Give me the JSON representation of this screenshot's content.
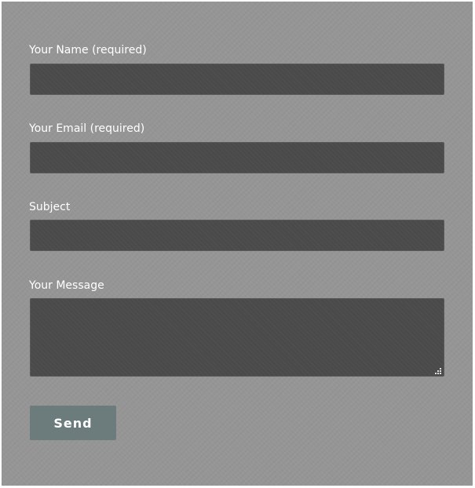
{
  "form": {
    "name_label": "Your Name (required)",
    "name_value": "",
    "email_label": "Your Email (required)",
    "email_value": "",
    "subject_label": "Subject",
    "subject_value": "",
    "message_label": "Your Message",
    "message_value": "",
    "send_label": "Send"
  },
  "colors": {
    "panel_bg": "#959595",
    "field_bg": "#4a4a4a",
    "button_bg": "#6c7b7c",
    "label_text": "#ffffff"
  },
  "icons": {
    "textarea_resize": "resize-grip-icon"
  }
}
